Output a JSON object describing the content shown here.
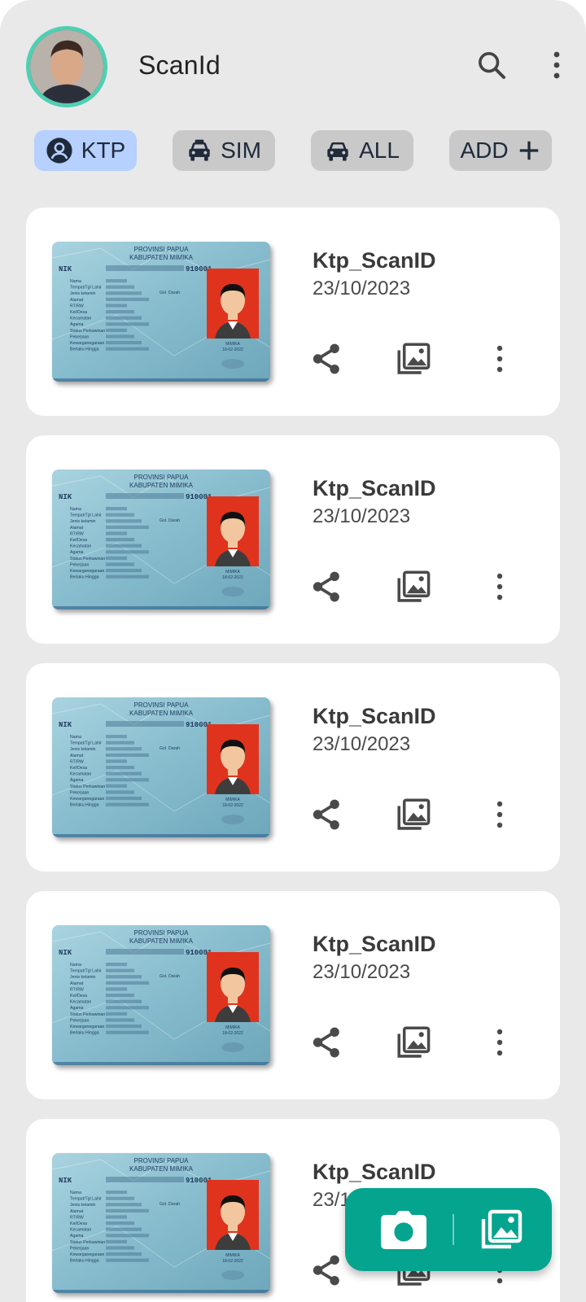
{
  "app": {
    "title": "ScanId"
  },
  "chips": [
    {
      "label": "KTP",
      "icon": "person-icon",
      "active": true
    },
    {
      "label": "SIM",
      "icon": "car-icon",
      "active": false
    },
    {
      "label": "ALL",
      "icon": "car-icon",
      "active": false
    },
    {
      "label": "ADD",
      "icon": "plus-icon",
      "active": false
    }
  ],
  "thumbnail": {
    "province": "PROVINSI PAPUA",
    "regency": "KABUPATEN MIMIKA",
    "nik_label": "NIK",
    "nik_value": "910001",
    "blood_label": "Gol. Darah",
    "city": "MIMIKA",
    "date": "18-02-2022",
    "field_labels": [
      "Nama",
      "Tempat/Tgl Lahir",
      "Jenis kelamin",
      "Alamat",
      "RT/RW",
      "Kel/Desa",
      "Kecamatan",
      "Agama",
      "Status Perkawinan",
      "Pekerjaan",
      "Kewarganegaraan",
      "Berlaku Hingga"
    ]
  },
  "cards": [
    {
      "title": "Ktp_ScanID",
      "date": "23/10/2023"
    },
    {
      "title": "Ktp_ScanID",
      "date": "23/10/2023"
    },
    {
      "title": "Ktp_ScanID",
      "date": "23/10/2023"
    },
    {
      "title": "Ktp_ScanID",
      "date": "23/10/2023"
    },
    {
      "title": "Ktp_ScanID",
      "date": "23/10/2023"
    }
  ],
  "colors": {
    "background": "#e9e9e9",
    "card": "#ffffff",
    "accent": "#05a48e",
    "chip_active": "#b6d0ff",
    "chip_inactive": "#c9c9c9",
    "avatar_ring": "#4fcfb3"
  },
  "icons": {
    "search": "search-icon",
    "menu": "more-vertical-icon",
    "share": "share-icon",
    "gallery": "gallery-icon",
    "more": "more-vertical-icon",
    "camera": "camera-icon"
  }
}
